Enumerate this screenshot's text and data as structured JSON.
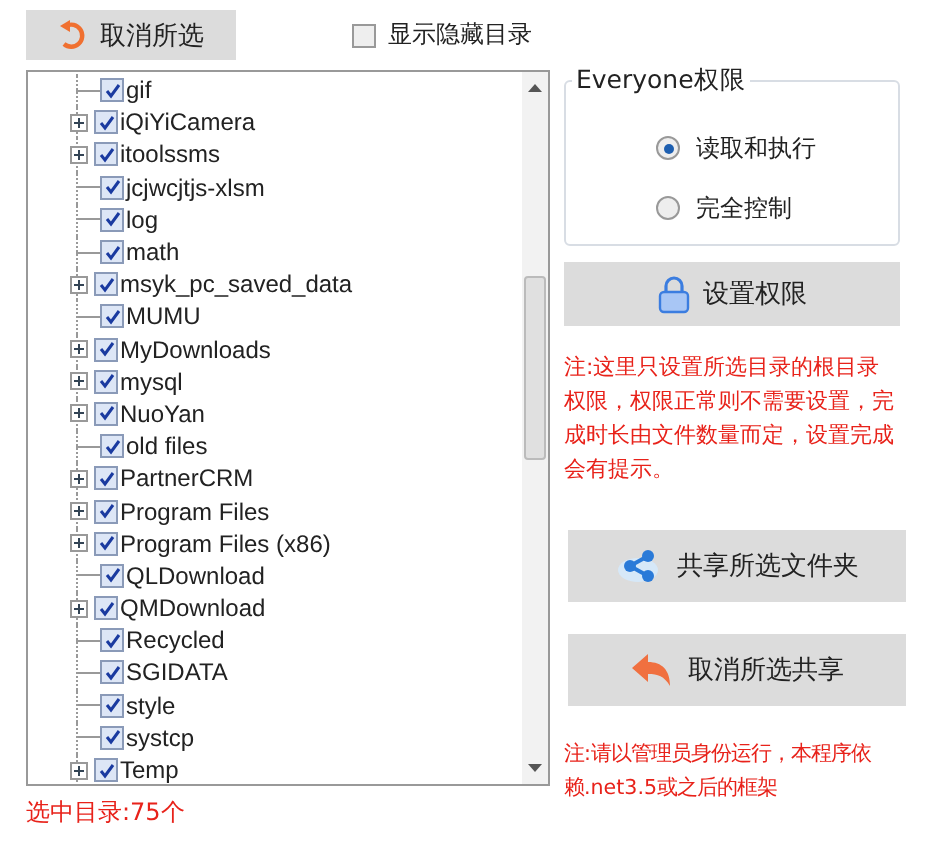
{
  "deselect_button": {
    "label": "取消所选"
  },
  "show_hidden": {
    "label": "显示隐藏目录",
    "checked": false
  },
  "tree": {
    "items": [
      {
        "label": "gif",
        "expandable": false,
        "checked": true
      },
      {
        "label": "iQiYiCamera",
        "expandable": true,
        "checked": true
      },
      {
        "label": "itoolssms",
        "expandable": true,
        "checked": true
      },
      {
        "label": "jcjwcjtjs-xlsm",
        "expandable": false,
        "checked": true
      },
      {
        "label": "log",
        "expandable": false,
        "checked": true
      },
      {
        "label": "math",
        "expandable": false,
        "checked": true
      },
      {
        "label": "msyk_pc_saved_data",
        "expandable": true,
        "checked": true
      },
      {
        "label": "MUMU",
        "expandable": false,
        "checked": true
      },
      {
        "label": "MyDownloads",
        "expandable": true,
        "checked": true
      },
      {
        "label": "mysql",
        "expandable": true,
        "checked": true
      },
      {
        "label": "NuoYan",
        "expandable": true,
        "checked": true
      },
      {
        "label": "old files",
        "expandable": false,
        "checked": true
      },
      {
        "label": "PartnerCRM",
        "expandable": true,
        "checked": true
      },
      {
        "label": "Program Files",
        "expandable": true,
        "checked": true
      },
      {
        "label": "Program Files (x86)",
        "expandable": true,
        "checked": true
      },
      {
        "label": "QLDownload",
        "expandable": false,
        "checked": true
      },
      {
        "label": "QMDownload",
        "expandable": true,
        "checked": true
      },
      {
        "label": "Recycled",
        "expandable": false,
        "checked": true
      },
      {
        "label": "SGIDATA",
        "expandable": false,
        "checked": true
      },
      {
        "label": "style",
        "expandable": false,
        "checked": true
      },
      {
        "label": "systcp",
        "expandable": false,
        "checked": true
      },
      {
        "label": "Temp",
        "expandable": true,
        "checked": true
      }
    ]
  },
  "selected_count": "选中目录:75个",
  "permissions": {
    "title": "Everyone权限",
    "options": [
      {
        "label": "读取和执行",
        "selected": true
      },
      {
        "label": "完全控制",
        "selected": false
      }
    ]
  },
  "set_permission_button": {
    "label": "设置权限"
  },
  "permission_note": "注:这里只设置所选目录的根目录权限，权限正常则不需要设置，完成时长由文件数量而定，设置完成会有提示。",
  "share_button": {
    "label": "共享所选文件夹"
  },
  "unshare_button": {
    "label": "取消所选共享"
  },
  "admin_note": "注:请以管理员身份运行，本程序依赖.net3.5或之后的框架"
}
